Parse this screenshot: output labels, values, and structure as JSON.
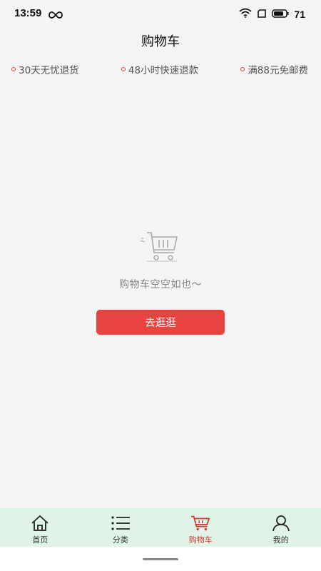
{
  "status_bar": {
    "time": "13:59",
    "battery": "71"
  },
  "header": {
    "title": "购物车"
  },
  "promo": {
    "items": [
      "30天无忧退货",
      "48小时快速退款",
      "满88元免邮费"
    ],
    "dot_color": "#e0434a"
  },
  "empty_state": {
    "icon": "shopping-cart-icon",
    "message": "购物车空空如也～",
    "button_label": "去逛逛",
    "button_color": "#e74341"
  },
  "tab_bar": {
    "background": "#dff3e6",
    "active_color": "#d23a34",
    "items": [
      {
        "label": "首页",
        "icon": "home-icon"
      },
      {
        "label": "分类",
        "icon": "list-icon"
      },
      {
        "label": "购物车",
        "icon": "cart-icon",
        "active": true
      },
      {
        "label": "我的",
        "icon": "user-icon"
      }
    ]
  }
}
